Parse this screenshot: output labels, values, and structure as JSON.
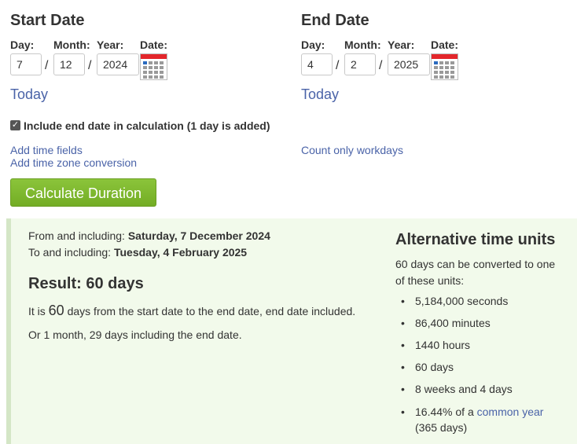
{
  "start": {
    "heading": "Start Date",
    "day_label": "Day:",
    "month_label": "Month:",
    "year_label": "Year:",
    "date_label": "Date:",
    "day": "7",
    "month": "12",
    "year": "2024",
    "today": "Today"
  },
  "end": {
    "heading": "End Date",
    "day_label": "Day:",
    "month_label": "Month:",
    "year_label": "Year:",
    "date_label": "Date:",
    "day": "4",
    "month": "2",
    "year": "2025",
    "today": "Today"
  },
  "separator": "/",
  "include_end_date": {
    "label": "Include end date in calculation (1 day is added)",
    "checked": true
  },
  "links": {
    "add_time_fields": "Add time fields",
    "add_time_zone": "Add time zone conversion",
    "count_workdays": "Count only workdays"
  },
  "calculate_button": "Calculate Duration",
  "result": {
    "from_prefix": "From and including:",
    "from_value": "Saturday, 7 December 2024",
    "to_prefix": "To and including:",
    "to_value": "Tuesday, 4 February 2025",
    "heading": "Result: 60 days",
    "line1_pre": "It is",
    "line1_num": "60",
    "line1_post": "days from the start date to the end date, end date included.",
    "line2": "Or 1 month, 29 days including the end date."
  },
  "alternative": {
    "heading": "Alternative time units",
    "intro": "60 days can be converted to one of these units:",
    "units": [
      "5,184,000 seconds",
      "86,400 minutes",
      "1440 hours",
      "60 days",
      "8 weeks and 4 days"
    ],
    "last_pre": "16.44% of a",
    "last_link": "common year",
    "last_post": "(365 days)"
  },
  "colors": {
    "link": "#4a63a8",
    "button": "#7cb82f",
    "result_bg": "#f2faeb",
    "calendar_red": "#e3262b"
  },
  "icons": {
    "calendar": "calendar-icon",
    "checkbox": "checkmark"
  }
}
